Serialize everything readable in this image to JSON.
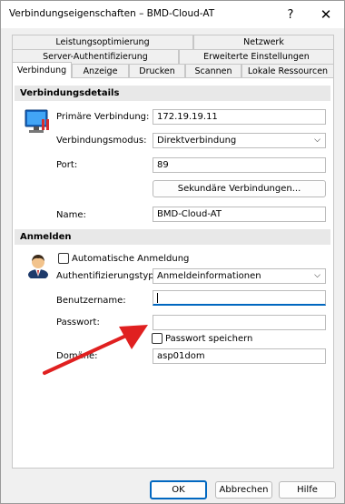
{
  "window": {
    "title": "Verbindungseigenschaften – BMD-Cloud-AT",
    "help_glyph": "?",
    "close_glyph": "✕"
  },
  "tabs": {
    "row1": [
      "Leistungsoptimierung",
      "Netzwerk"
    ],
    "row2": [
      "Server-Authentifizierung",
      "Erweiterte Einstellungen"
    ],
    "row3": [
      "Verbindung",
      "Anzeige",
      "Drucken",
      "Scannen",
      "Lokale Ressourcen"
    ],
    "active": "Verbindung"
  },
  "connection": {
    "section_title": "Verbindungsdetails",
    "primary_label": "Primäre Verbindung:",
    "primary_value": "172.19.19.11",
    "mode_label": "Verbindungsmodus:",
    "mode_value": "Direktverbindung",
    "port_label": "Port:",
    "port_value": "89",
    "secondary_button": "Sekundäre Verbindungen...",
    "name_label": "Name:",
    "name_value": "BMD-Cloud-AT"
  },
  "login": {
    "section_title": "Anmelden",
    "auto_login_label": "Automatische Anmeldung",
    "auto_login_checked": false,
    "auth_type_label": "Authentifizierungstyp:",
    "auth_type_value": "Anmeldeinformationen",
    "username_label": "Benutzername:",
    "username_value": "",
    "password_label": "Passwort:",
    "password_value": "",
    "save_password_label": "Passwort speichern",
    "save_password_checked": false,
    "domain_label": "Domäne:",
    "domain_value": "asp01dom"
  },
  "footer": {
    "ok_label": "OK",
    "cancel_label": "Abbrechen",
    "help_label": "Hilfe"
  },
  "colors": {
    "accent": "#0067c0",
    "arrow": "#e02020",
    "section_bg": "#e8e8e8"
  }
}
